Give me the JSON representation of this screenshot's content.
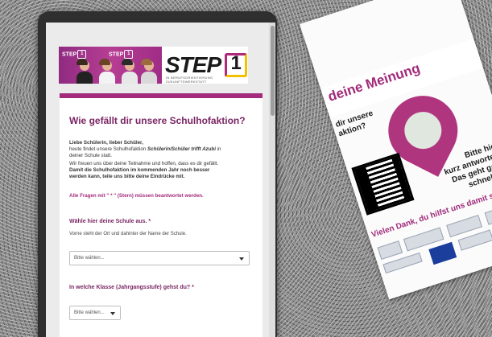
{
  "flyer": {
    "title": "deine Meinung",
    "question_lines": [
      "dir unsere",
      "aktion?"
    ],
    "cta_lines": [
      "Bitte hier",
      "kurz antworten.",
      "Das geht ganz",
      "schnell.  ;-)"
    ],
    "thanks": "Vielen Dank, du hilfst uns damit sehr."
  },
  "banner": {
    "chip_text": "STEP",
    "chip_num": "1",
    "logo_word": "STEP",
    "logo_num": "1",
    "logo_subtitle": "IN BERUFSORIENTIERUNG ZUKUNFTSWERKSTATT"
  },
  "form": {
    "title": "Wie gefällt dir unsere Schulhofaktion?",
    "greeting": "Liebe Schülerin, lieber Schüler,",
    "intro_pre": "heute findet unsere Schulhofaktion ",
    "intro_em": "Schülerin/Schüler trifft Azubi",
    "intro_post": " in",
    "intro_line2": "deiner Schule statt.",
    "thanks_line": "Wir freuen uns über deine Teilnahme und hoffen, dass es dir gefällt.",
    "bold_line1": "Damit die Schulhofaktion im kommenden Jahr noch besser",
    "bold_line2": "werden kann, teile uns bitte deine Eindrücke mit.",
    "required_note": "Alle Fragen mit \" * \" (Stern) müssen beantwortet werden.",
    "q1_label": "Wähle hier deine Schule aus. *",
    "q1_hint": "Vorne steht der Ort und dahinter der Name der Schule.",
    "q1_value": "Bitte wählen...",
    "q2_label": "In welche Klasse (Jahrgangsstufe) gehst du? *",
    "q2_value": "Bitte wählen..."
  },
  "colors": {
    "accent": "#a32a7c",
    "title": "#7a2463",
    "logo_yellow": "#f2c200"
  }
}
